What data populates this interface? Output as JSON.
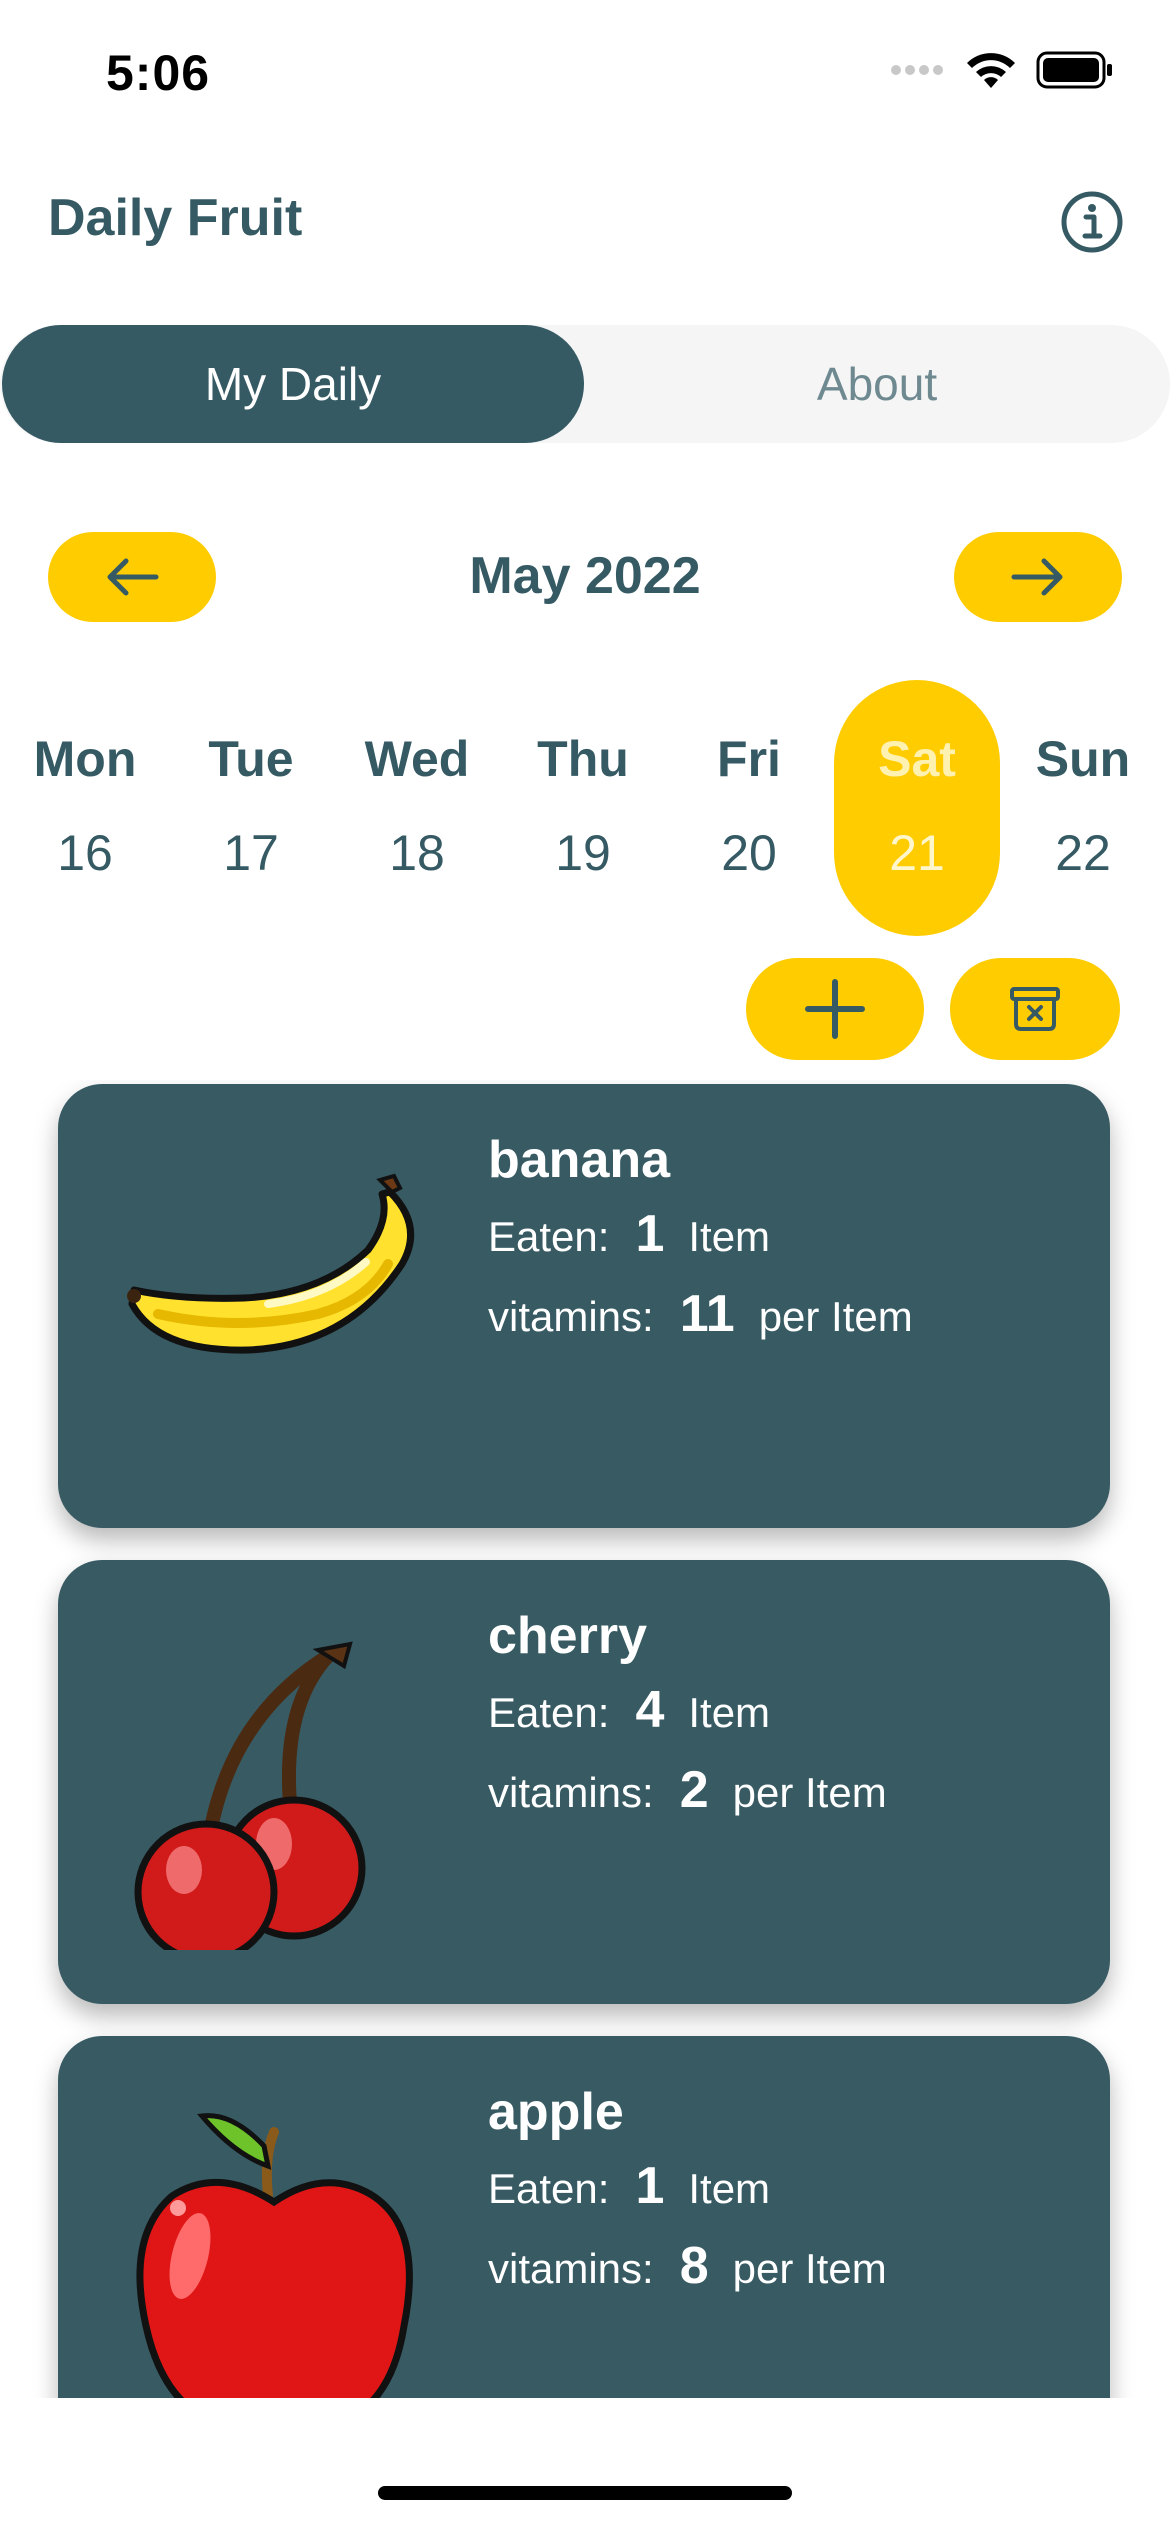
{
  "status_bar": {
    "time": "5:06"
  },
  "header": {
    "title": "Daily Fruit"
  },
  "tabs": [
    {
      "label": "My Daily",
      "active": true
    },
    {
      "label": "About",
      "active": false
    }
  ],
  "calendar": {
    "month": "May 2022",
    "days": [
      {
        "name": "Mon",
        "num": "16"
      },
      {
        "name": "Tue",
        "num": "17"
      },
      {
        "name": "Wed",
        "num": "18"
      },
      {
        "name": "Thu",
        "num": "19"
      },
      {
        "name": "Fri",
        "num": "20"
      },
      {
        "name": "Sat",
        "num": "21",
        "selected": true
      },
      {
        "name": "Sun",
        "num": "22"
      }
    ]
  },
  "fruits": [
    {
      "name": "banana",
      "eaten_label": "Eaten:",
      "eaten": "1",
      "eaten_unit": "Item",
      "vitamins_label": "vitamins:",
      "vitamins": "11",
      "vitamins_unit": "per Item",
      "icon": "banana-icon"
    },
    {
      "name": "cherry",
      "eaten_label": "Eaten:",
      "eaten": "4",
      "eaten_unit": "Item",
      "vitamins_label": "vitamins:",
      "vitamins": "2",
      "vitamins_unit": "per Item",
      "icon": "cherry-icon"
    },
    {
      "name": "apple",
      "eaten_label": "Eaten:",
      "eaten": "1",
      "eaten_unit": "Item",
      "vitamins_label": "vitamins:",
      "vitamins": "8",
      "vitamins_unit": "per Item",
      "icon": "apple-icon"
    }
  ],
  "colors": {
    "primary": "#365a64",
    "accent": "#ffcc00",
    "tab_bg": "#f5f5f5"
  }
}
